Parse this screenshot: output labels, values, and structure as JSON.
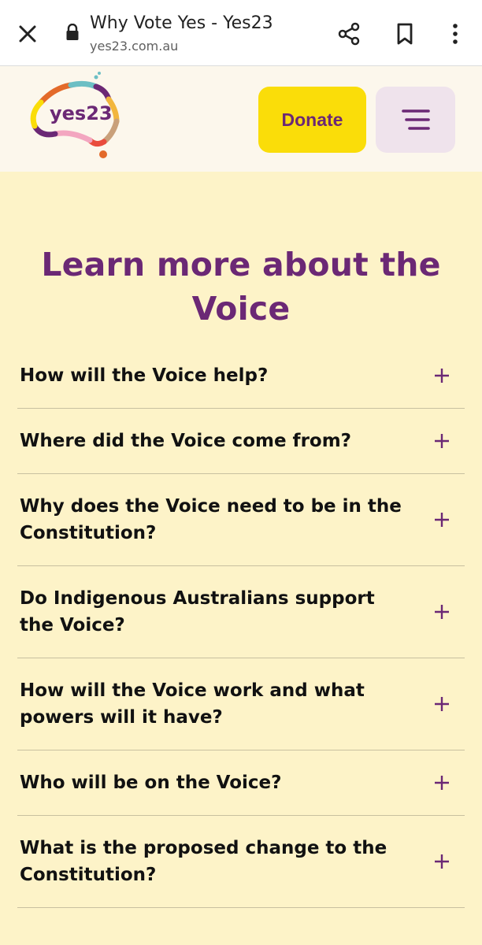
{
  "browser": {
    "tab_title": "Why Vote Yes - Yes23",
    "url": "yes23.com.au",
    "icons": [
      "close-icon",
      "lock-icon",
      "share-icon",
      "bookmark-icon",
      "more-vert-icon"
    ]
  },
  "header": {
    "logo_text": "yes23",
    "donate_label": "Donate",
    "menu_icon": "hamburger-menu-icon"
  },
  "colors": {
    "brand_purple": "#6b2875",
    "donate_yellow": "#fadd09",
    "page_background": "#fdf3c8"
  },
  "main": {
    "heading": "Learn more about the Voice",
    "faq": [
      {
        "question": "How will the Voice help?"
      },
      {
        "question": "Where did the Voice come from?"
      },
      {
        "question": "Why does the Voice need to be in the Constitution?"
      },
      {
        "question": "Do Indigenous Australians support the Voice?"
      },
      {
        "question": "How will the Voice work and what powers will it have?"
      },
      {
        "question": "Who will be on the Voice?"
      },
      {
        "question": "What is the proposed change to the Constitution?"
      }
    ]
  }
}
